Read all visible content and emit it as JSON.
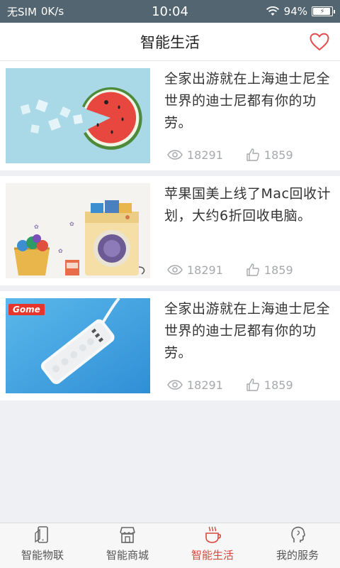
{
  "status_bar": {
    "carrier": "无SIM",
    "speed": "0K/s",
    "time": "10:04",
    "battery": "94%",
    "battery_level": 0.94
  },
  "header": {
    "title": "智能生活",
    "favorite_icon": "heart-icon"
  },
  "feed": [
    {
      "title": "全家出游就在上海迪士尼全世界的迪士尼都有你的功劳。",
      "views": "18291",
      "likes": "1859",
      "thumb": "watermelon-image"
    },
    {
      "title": "苹果国美上线了Mac回收计划，大约6折回收电脑。",
      "views": "18291",
      "likes": "1859",
      "thumb": "washing-machine-image"
    },
    {
      "title": "全家出游就在上海迪士尼全世界的迪士尼都有你的功劳。",
      "views": "18291",
      "likes": "1859",
      "thumb": "power-strip-image",
      "thumb_logo": "Gome"
    }
  ],
  "tabs": [
    {
      "label": "智能物联",
      "icon": "phone-icon"
    },
    {
      "label": "智能商城",
      "icon": "store-icon"
    },
    {
      "label": "智能生活",
      "icon": "coffee-cup-icon",
      "active": true
    },
    {
      "label": "我的服务",
      "icon": "head-icon"
    }
  ],
  "colors": {
    "status_bar": "#536570",
    "accent": "#d9473a",
    "stat_gray": "#a6a9ad"
  }
}
